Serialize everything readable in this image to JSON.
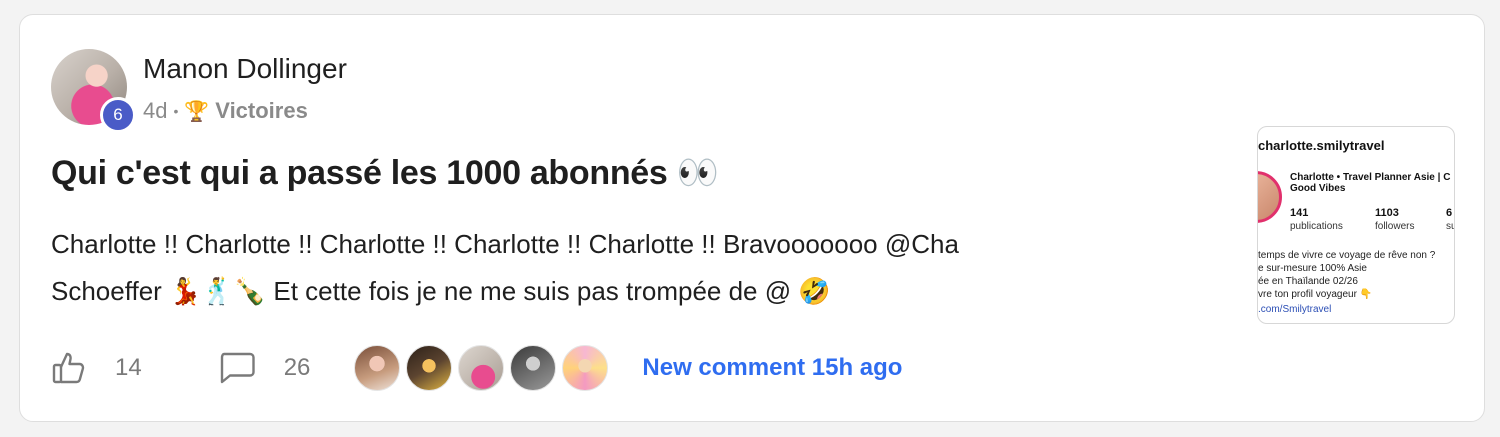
{
  "post": {
    "author": "Manon Dollinger",
    "level": "6",
    "time": "4d",
    "separator": "•",
    "category_icon": "🏆",
    "category": "Victoires",
    "title": "Qui c'est qui a passé les 1000 abonnés 👀",
    "body_line1": "Charlotte !! Charlotte !! Charlotte !! Charlotte !! Charlotte !! Bravooooooo @Cha",
    "body_line2": "Schoeffer 💃🕺🍾 Et cette fois je ne me suis pas trompée de @ 🤣"
  },
  "actions": {
    "likes": "14",
    "comments": "26",
    "new_comment": "New comment 15h ago"
  },
  "commenters": [
    {
      "name": "commenter-1"
    },
    {
      "name": "commenter-2"
    },
    {
      "name": "commenter-3"
    },
    {
      "name": "commenter-4"
    },
    {
      "name": "commenter-5"
    }
  ],
  "thumbnail": {
    "handle": "charlotte.smilytravel",
    "display_name": "Charlotte • Travel Planner Asie | C",
    "display_name2": "Good Vibes",
    "stats": [
      {
        "value": "141",
        "label": "publications"
      },
      {
        "value": "1103",
        "label": "followers"
      },
      {
        "value": "6",
        "label": "su"
      }
    ],
    "bio": "temps de vivre ce voyage de rêve non ?\ne sur-mesure 100% Asie\née en Thaïlande 02/26\nvre ton profil voyageur 👇",
    "link": ".com/Smilytravel"
  },
  "colors": {
    "accent": "#2f6df0",
    "level_badge": "#4a5bc7",
    "muted": "#8a8a8a"
  },
  "icons": {
    "like": "thumbs-up-icon",
    "comment": "comment-icon"
  }
}
